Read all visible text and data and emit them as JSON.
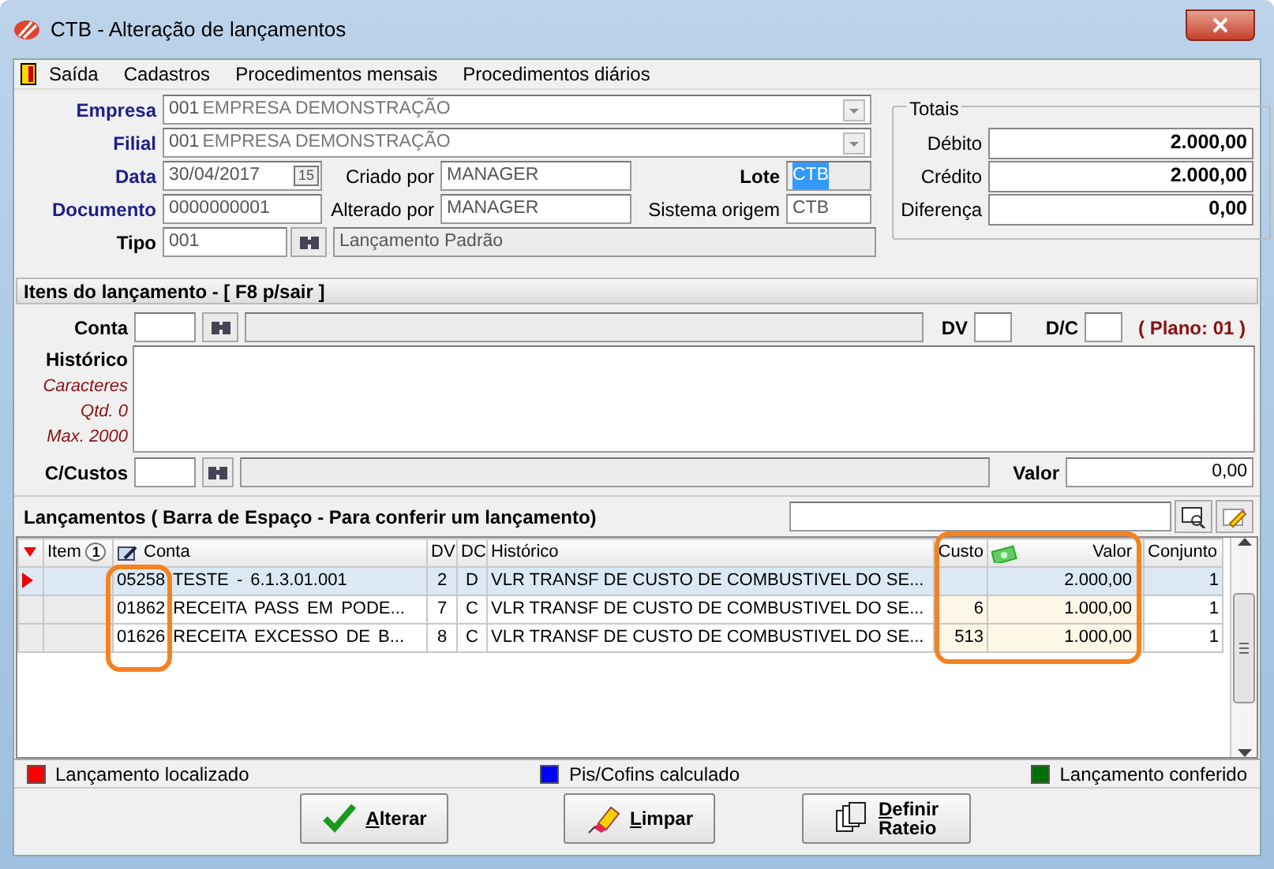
{
  "window": {
    "title": "CTB - Alteração de lançamentos"
  },
  "menu": [
    "Saída",
    "Cadastros",
    "Procedimentos mensais",
    "Procedimentos diários"
  ],
  "header": {
    "empresa": {
      "label": "Empresa",
      "code": "001",
      "name": "EMPRESA DEMONSTRAÇÃO"
    },
    "filial": {
      "label": "Filial",
      "code": "001",
      "name": "EMPRESA DEMONSTRAÇÃO"
    },
    "data": {
      "label": "Data",
      "value": "30/04/2017",
      "calendar": "15"
    },
    "documento": {
      "label": "Documento",
      "value": "0000000001"
    },
    "tipo": {
      "label": "Tipo",
      "value": "001",
      "description": "Lançamento Padrão"
    },
    "criado_por": {
      "label": "Criado por",
      "value": "MANAGER"
    },
    "alterado_por": {
      "label": "Alterado por",
      "value": "MANAGER"
    },
    "lote": {
      "label": "Lote",
      "value": "CTB"
    },
    "sistema_origem": {
      "label": "Sistema origem",
      "value": "CTB"
    }
  },
  "totais": {
    "title": "Totais",
    "rows": [
      {
        "label": "Débito",
        "value": "2.000,00"
      },
      {
        "label": "Crédito",
        "value": "2.000,00"
      },
      {
        "label": "Diferença",
        "value": "0,00"
      }
    ]
  },
  "itens": {
    "title": "Itens do lançamento - [ F8 p/sair ]",
    "conta_label": "Conta",
    "dv_label": "DV",
    "dc_label": "D/C",
    "plano": "( Plano: 01 )",
    "historico_label": "Histórico",
    "hints": [
      "Caracteres",
      "Qtd. 0",
      "Max. 2000"
    ],
    "ccustos_label": "C/Custos",
    "valor_label": "Valor",
    "valor": "0,00"
  },
  "lancamentos": {
    "title": "Lançamentos ( Barra de Espaço - Para conferir um lançamento)",
    "columns": [
      "Item",
      "Conta",
      "DV",
      "DC",
      "Histórico",
      "Custo",
      "Valor",
      "Conjunto"
    ],
    "sort_badge": "1",
    "rows": [
      {
        "selected": true,
        "conta": "05258 TESTE - 6.1.3.01.001",
        "dv": "2",
        "dc": "D",
        "historico": "VLR TRANSF DE CUSTO DE COMBUSTIVEL DO SE...",
        "custo": "",
        "valor": "2.000,00",
        "conjunto": "1"
      },
      {
        "selected": false,
        "conta": "01862 RECEITA PASS EM PODE...",
        "dv": "7",
        "dc": "C",
        "historico": "VLR TRANSF DE CUSTO DE COMBUSTIVEL DO SE...",
        "custo": "6",
        "valor": "1.000,00",
        "conjunto": "1"
      },
      {
        "selected": false,
        "conta": "01626 RECEITA EXCESSO DE B...",
        "dv": "8",
        "dc": "C",
        "historico": "VLR TRANSF DE CUSTO DE COMBUSTIVEL DO SE...",
        "custo": "513",
        "valor": "1.000,00",
        "conjunto": "1"
      }
    ]
  },
  "legend": [
    {
      "label": "Lançamento localizado",
      "color": "#ff0000"
    },
    {
      "label": "Pis/Cofins calculado",
      "color": "#0000ff"
    },
    {
      "label": "Lançamento conferido",
      "color": "#007000"
    }
  ],
  "buttons": [
    {
      "kind": "check",
      "label": "Alterar"
    },
    {
      "kind": "eraser",
      "label": "Limpar"
    },
    {
      "kind": "pages",
      "label": "Definir Rateio"
    }
  ]
}
